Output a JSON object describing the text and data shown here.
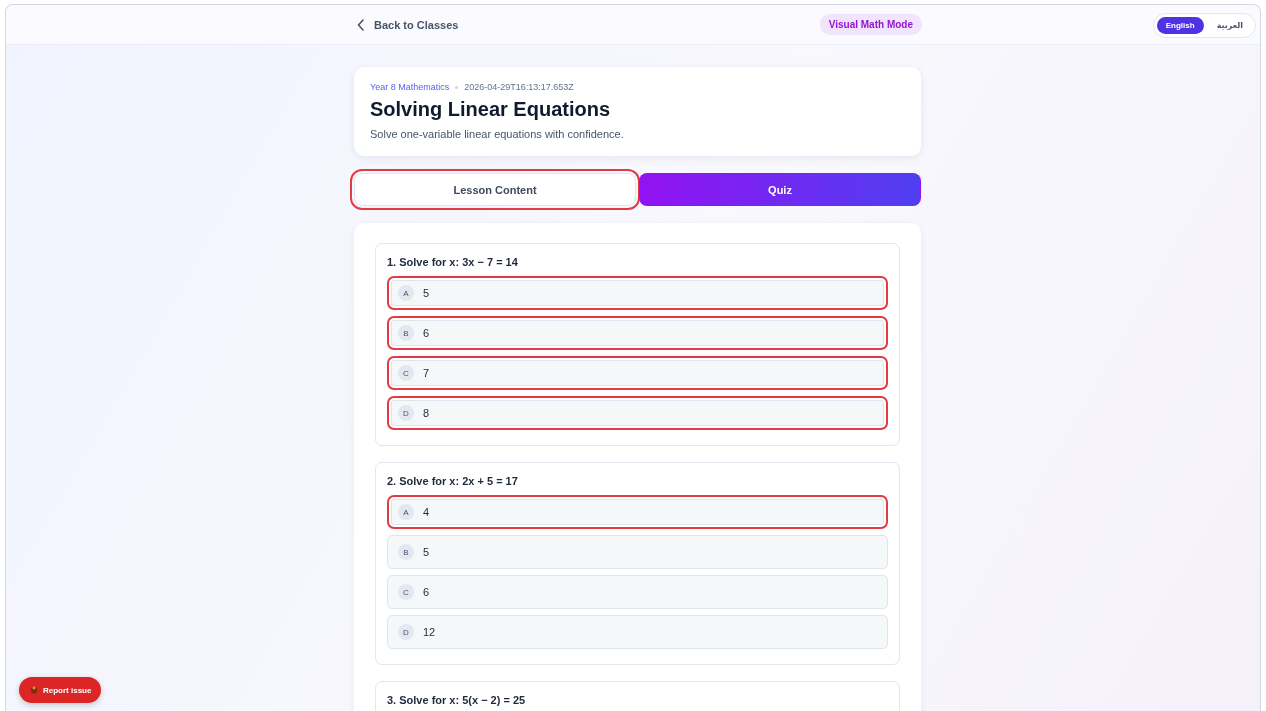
{
  "header": {
    "back_link": "Back to Classes",
    "mode_badge": "Visual Math Mode"
  },
  "languages": [
    {
      "label": "English",
      "selected": true
    },
    {
      "label": "العربية",
      "selected": false
    }
  ],
  "lesson": {
    "course": "Year 8 Mathematics",
    "timestamp": "2026-04-29T16:13:17.653Z",
    "title": "Solving Linear Equations",
    "description": "Solve one-variable linear equations with confidence."
  },
  "tabs": [
    {
      "label": "Lesson Content",
      "selected": false,
      "flagged": true
    },
    {
      "label": "Quiz",
      "selected": true,
      "flagged": false
    }
  ],
  "questions": [
    {
      "text": "1. Solve for x: 3x − 7 = 14",
      "options": [
        {
          "letter": "A",
          "text": "5",
          "flagged": true
        },
        {
          "letter": "B",
          "text": "6",
          "flagged": true
        },
        {
          "letter": "C",
          "text": "7",
          "flagged": true
        },
        {
          "letter": "D",
          "text": "8",
          "flagged": true
        }
      ]
    },
    {
      "text": "2. Solve for x: 2x + 5 = 17",
      "options": [
        {
          "letter": "A",
          "text": "4",
          "flagged": true
        },
        {
          "letter": "B",
          "text": "5",
          "flagged": false
        },
        {
          "letter": "C",
          "text": "6",
          "flagged": false
        },
        {
          "letter": "D",
          "text": "12",
          "flagged": false
        }
      ]
    },
    {
      "text": "3. Solve for x: 5(x − 2) = 25"
    }
  ],
  "report_button": "Report issue"
}
